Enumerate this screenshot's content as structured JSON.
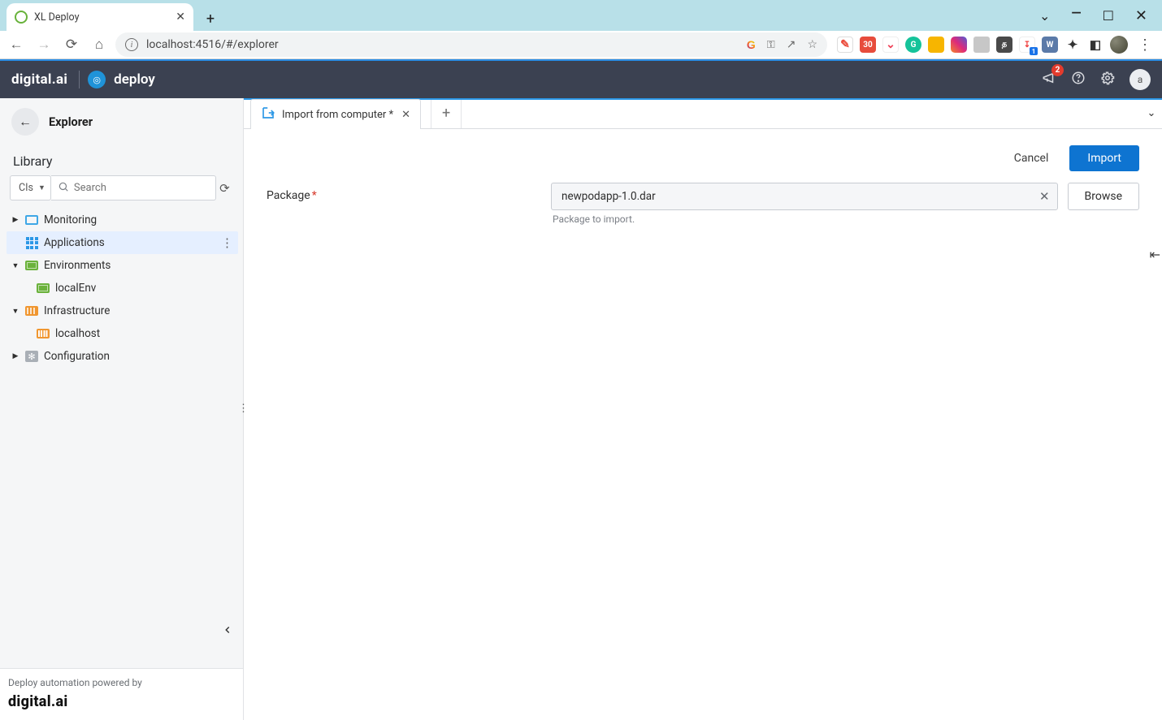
{
  "browser": {
    "tab_title": "XL Deploy",
    "url_display": "localhost:4516/#/explorer",
    "extensions": [
      {
        "name": "translate",
        "bg": "#fff",
        "fg": "#e74c3c",
        "txt": ""
      },
      {
        "name": "cal",
        "bg": "#e74c3c",
        "fg": "#fff",
        "txt": "30"
      },
      {
        "name": "pocket",
        "bg": "#fff",
        "fg": "#ee4056",
        "txt": "◡"
      },
      {
        "name": "grammarly",
        "bg": "#15c39a",
        "fg": "#fff",
        "txt": "G"
      },
      {
        "name": "keep",
        "bg": "#f7b500",
        "fg": "#fff",
        "txt": ""
      },
      {
        "name": "insta",
        "bg": "linear-gradient(45deg,#f58529,#dd2a7b,#515bd4)",
        "fg": "#fff",
        "txt": ""
      },
      {
        "name": "app1",
        "bg": "#c7c7c7",
        "fg": "#fff",
        "txt": ""
      },
      {
        "name": "tamil",
        "bg": "#494949",
        "fg": "#fff",
        "txt": "த"
      },
      {
        "name": "pin",
        "bg": "#fff",
        "fg": "#ef3e3e",
        "txt": "↧",
        "badge": "1"
      },
      {
        "name": "word",
        "bg": "#5b7aa8",
        "fg": "#fff",
        "txt": "W"
      },
      {
        "name": "puzzle",
        "bg": "transparent",
        "fg": "#333",
        "txt": "✦"
      },
      {
        "name": "panel",
        "bg": "transparent",
        "fg": "#333",
        "txt": "◧"
      }
    ]
  },
  "header": {
    "brand_primary": "digital.ai",
    "brand_product": "deploy",
    "notification_count": "2",
    "user_initial": "a"
  },
  "sidebar": {
    "title": "Explorer",
    "section": "Library",
    "filter_button": "CIs",
    "search_placeholder": "Search",
    "nodes": {
      "monitoring": "Monitoring",
      "applications": "Applications",
      "environments": "Environments",
      "localenv": "localEnv",
      "infrastructure": "Infrastructure",
      "localhost": "localhost",
      "configuration": "Configuration"
    },
    "footer_label": "Deploy automation powered by",
    "footer_brand": "digital.ai"
  },
  "workspace": {
    "tab_label": "Import from computer *",
    "cancel": "Cancel",
    "import": "Import",
    "form": {
      "package_label": "Package",
      "package_value": "newpodapp-1.0.dar",
      "package_hint": "Package to import.",
      "browse": "Browse"
    }
  }
}
